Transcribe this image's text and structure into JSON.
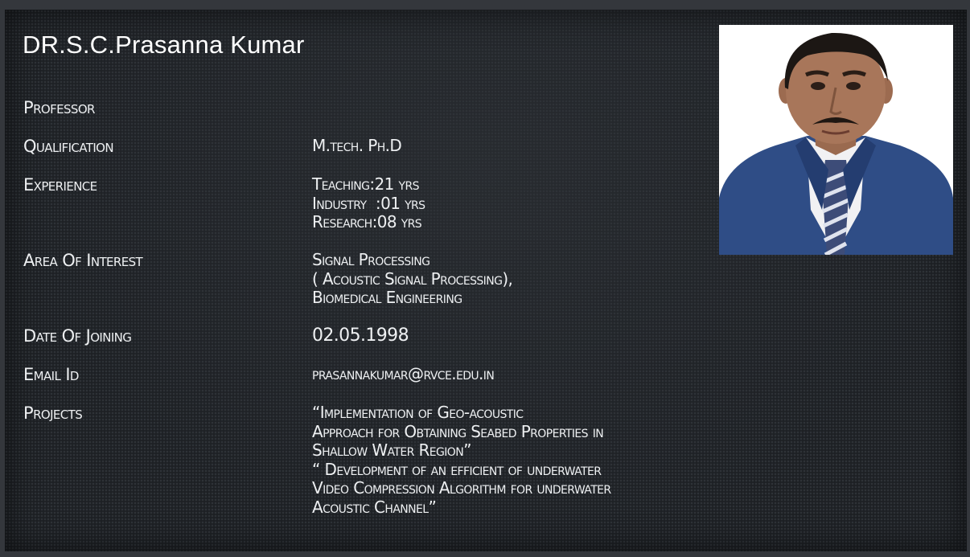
{
  "title": "DR.S.C.Prasanna Kumar",
  "designation": "Professor",
  "fields": {
    "qualification": {
      "label": "Qualification",
      "value": "M.tech. Ph.D"
    },
    "experience": {
      "label": "Experience",
      "lines": [
        "Teaching:21 yrs",
        "Industry  :01 yrs",
        "Research:08 yrs"
      ]
    },
    "area_of_interest": {
      "label": "Area Of Interest",
      "lines": [
        "Signal Processing",
        "( Acoustic Signal Processing),",
        "Biomedical Engineering"
      ]
    },
    "date_of_joining": {
      "label": "Date Of Joining",
      "value": "02.05.1998"
    },
    "email": {
      "label": "Email Id",
      "value": "prasannakumar@rvce.edu.in"
    },
    "projects": {
      "label": "Projects",
      "lines": [
        "“Implementation of Geo-acoustic",
        "Approach for Obtaining Seabed Properties in",
        "Shallow Water Region”",
        "“ Development of an efficient of underwater",
        "Video Compression Algorithm for underwater",
        "Acoustic Channel”"
      ]
    }
  }
}
